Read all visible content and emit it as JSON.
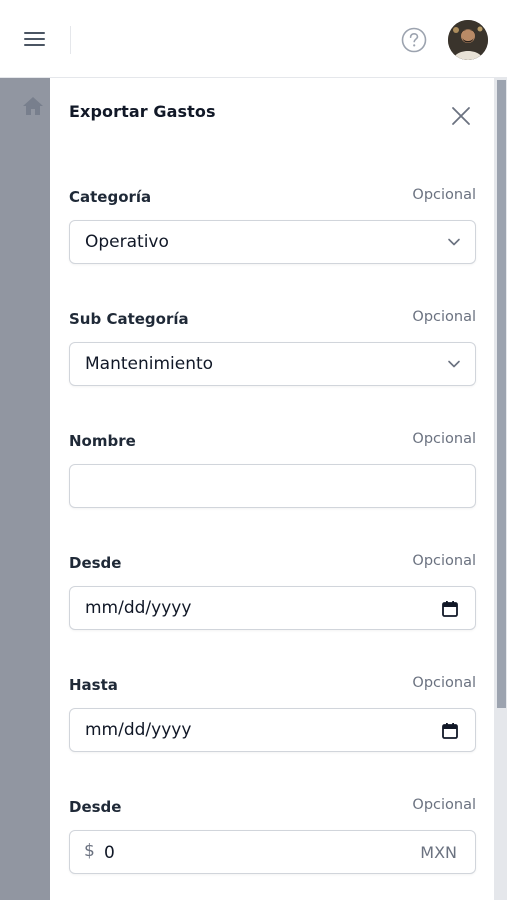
{
  "drawer": {
    "title": "Exportar Gastos",
    "fields": [
      {
        "label": "Categoría",
        "optional": "Opcional",
        "value": "Operativo"
      },
      {
        "label": "Sub Categoría",
        "optional": "Opcional",
        "value": "Mantenimiento"
      },
      {
        "label": "Nombre",
        "optional": "Opcional",
        "value": ""
      },
      {
        "label": "Desde",
        "optional": "Opcional",
        "placeholder": "mm/dd/yyyy"
      },
      {
        "label": "Hasta",
        "optional": "Opcional",
        "placeholder": "mm/dd/yyyy"
      },
      {
        "label": "Desde",
        "optional": "Opcional",
        "prefix": "$",
        "value": "0",
        "currency": "MXN"
      }
    ]
  },
  "icons": {
    "menu": "hamburger-icon",
    "help": "help-circle-icon",
    "close": "close-icon",
    "chevron": "chevron-down-icon",
    "calendar": "calendar-icon",
    "home": "home-icon"
  },
  "colors": {
    "overlay": "#6b7280",
    "border": "#d1d5db",
    "text": "#111827",
    "muted": "#6b7280"
  }
}
